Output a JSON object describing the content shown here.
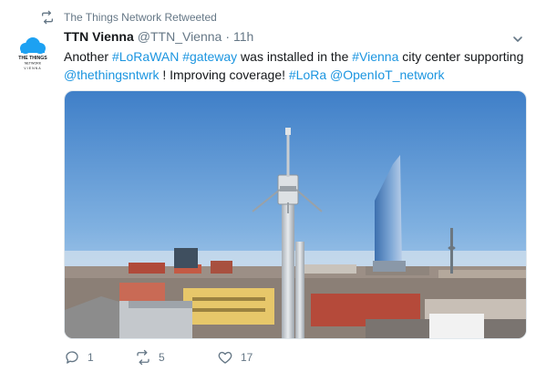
{
  "retweet_notice": {
    "text": "The Things Network Retweeted"
  },
  "tweet": {
    "author_name": "TTN Vienna",
    "author_handle": "@TTN_Vienna",
    "separator": "·",
    "time": "11h",
    "text_parts": [
      "Another ",
      "#LoRaWAN",
      " ",
      "#gateway",
      " was installed in the ",
      "#Vienna",
      " city center supporting ",
      "@thethingsntwrk",
      " ! Improving coverage! ",
      "#LoRa",
      " ",
      "@OpenIoT_network"
    ],
    "avatar": {
      "line1": "THE THINGS",
      "line2": "NETWORK",
      "line3": "VIENNA"
    }
  },
  "actions": {
    "reply_count": "1",
    "retweet_count": "5",
    "like_count": "17"
  },
  "colors": {
    "link": "#1b95e0",
    "meta": "#657786",
    "brand": "#1da1f2"
  },
  "icons": [
    "retweet-icon",
    "caret-down-icon",
    "reply-icon",
    "like-icon"
  ]
}
